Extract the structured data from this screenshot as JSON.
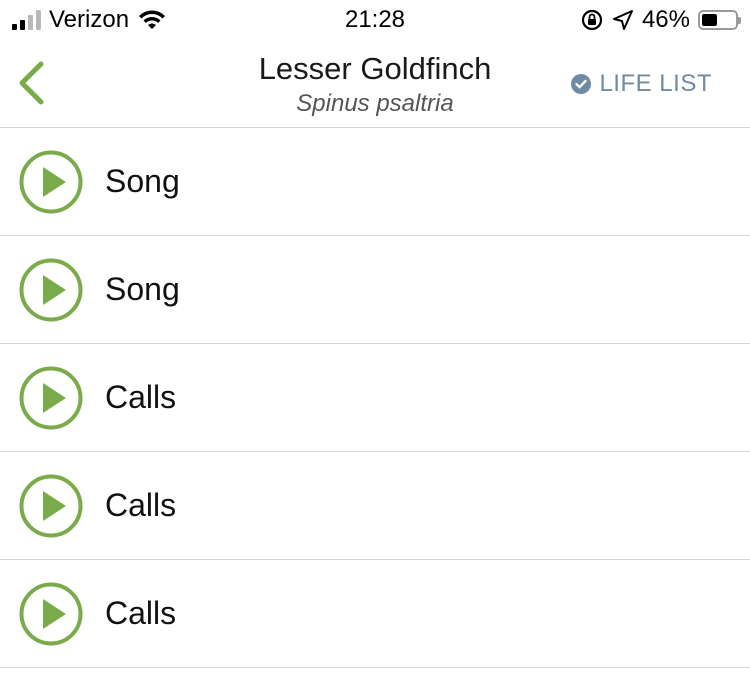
{
  "status_bar": {
    "carrier": "Verizon",
    "time": "21:28",
    "battery_percent": "46%",
    "battery_level": 0.46,
    "icons": [
      "signal-icon",
      "wifi-icon",
      "orientation-lock-icon",
      "location-icon",
      "battery-icon"
    ]
  },
  "nav": {
    "back_icon": "chevron-left-icon",
    "title": "Lesser Goldfinch",
    "subtitle": "Spinus psaltria",
    "life_list_label": "LIFE LIST",
    "life_list_icon": "check-circle-icon"
  },
  "recordings": [
    {
      "label": "Song"
    },
    {
      "label": "Song"
    },
    {
      "label": "Calls"
    },
    {
      "label": "Calls"
    },
    {
      "label": "Calls"
    }
  ],
  "colors": {
    "accent_green": "#7aab4a",
    "life_list_blue": "#6f8aa3",
    "divider": "#d6d6d6"
  }
}
